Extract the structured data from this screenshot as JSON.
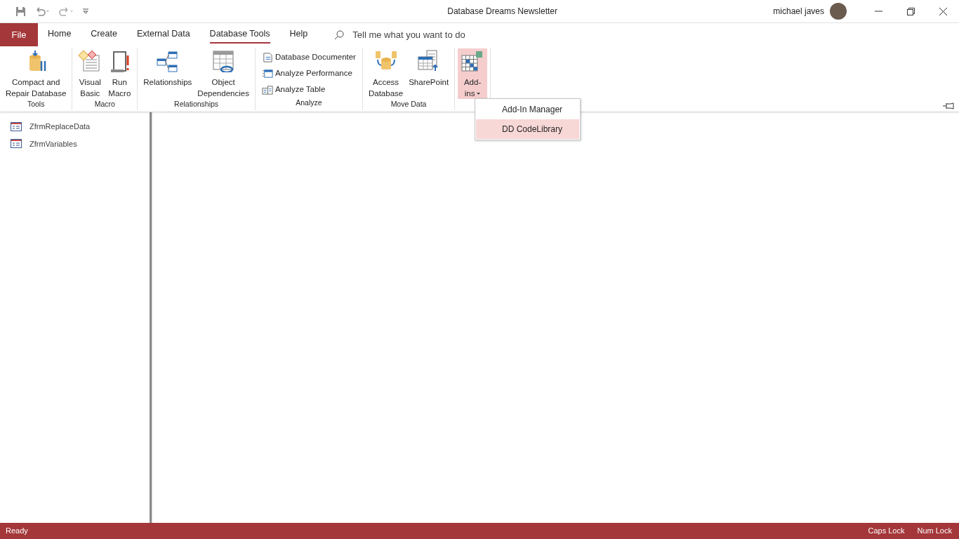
{
  "window": {
    "title": "Database Dreams Newsletter",
    "user": "michael javes"
  },
  "tabs": [
    {
      "label": "File",
      "kind": "file",
      "selected": false
    },
    {
      "label": "Home",
      "kind": "tab",
      "selected": false
    },
    {
      "label": "Create",
      "kind": "tab",
      "selected": false
    },
    {
      "label": "External Data",
      "kind": "tab",
      "selected": false
    },
    {
      "label": "Database Tools",
      "kind": "tab",
      "selected": true
    },
    {
      "label": "Help",
      "kind": "tab",
      "selected": false
    }
  ],
  "tell_me": {
    "placeholder": "Tell me what you want to do"
  },
  "ribbon_groups": [
    {
      "label": "Tools",
      "items": [
        {
          "kind": "large",
          "label": [
            "Compact and",
            "Repair Database"
          ],
          "pressed": false
        }
      ]
    },
    {
      "label": "Macro",
      "items": [
        {
          "kind": "large",
          "label": [
            "Visual",
            "Basic"
          ],
          "pressed": false
        },
        {
          "kind": "large",
          "label": [
            "Run",
            "Macro"
          ],
          "pressed": false
        }
      ]
    },
    {
      "label": "Relationships",
      "items": [
        {
          "kind": "large",
          "label": [
            "Relationships"
          ],
          "pressed": false
        },
        {
          "kind": "large",
          "label": [
            "Object",
            "Dependencies"
          ],
          "pressed": false
        }
      ]
    },
    {
      "label": "Analyze",
      "items": [
        {
          "kind": "small",
          "label": [
            "Database Documenter"
          ],
          "pressed": false
        },
        {
          "kind": "small",
          "label": [
            "Analyze Performance"
          ],
          "pressed": false
        },
        {
          "kind": "small",
          "label": [
            "Analyze Table"
          ],
          "pressed": false
        }
      ]
    },
    {
      "label": "Move Data",
      "items": [
        {
          "kind": "large",
          "label": [
            "Access",
            "Database"
          ],
          "pressed": false
        },
        {
          "kind": "large",
          "label": [
            "SharePoint"
          ],
          "pressed": false
        }
      ]
    },
    {
      "items": [
        {
          "kind": "dropdown",
          "label": [
            "Add-",
            "ins"
          ],
          "pressed": true
        }
      ]
    }
  ],
  "addins_menu": [
    {
      "label": "Add-In Manager",
      "selected": false
    },
    {
      "label": "DD CodeLibrary",
      "selected": true
    }
  ],
  "nav_pane": {
    "items": [
      {
        "label": "ZfrmReplaceData"
      },
      {
        "label": "ZfrmVariables"
      }
    ]
  },
  "status_bar": {
    "left": "Ready",
    "right": [
      "Caps Lock",
      "Num Lock"
    ]
  }
}
